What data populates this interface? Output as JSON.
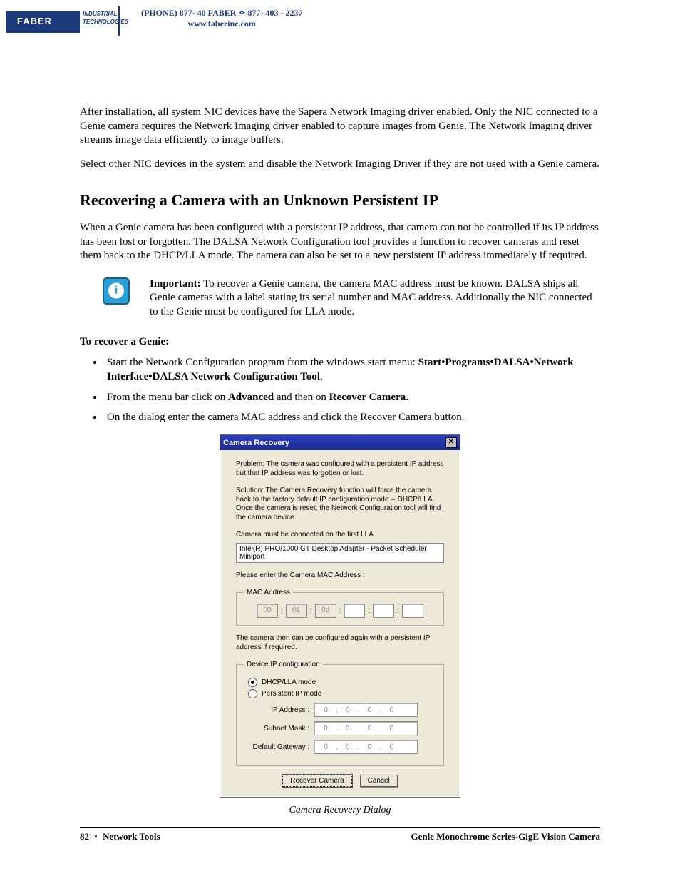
{
  "header": {
    "logo_main": "FABER",
    "logo_sub1": "INDUSTRIAL",
    "logo_sub2": "TECHNOLOGIES",
    "phone_line": "(PHONE) 877- 40 FABER  ✧  877- 403 - 2237",
    "url": "www.faberinc.com"
  },
  "body": {
    "para1": "After installation, all system NIC devices have the Sapera Network Imaging driver enabled. Only the NIC connected to a Genie camera requires the Network Imaging driver enabled to capture images from Genie. The Network Imaging driver streams image data efficiently to image buffers.",
    "para2": "Select other NIC devices in the system and disable the Network Imaging Driver if they are not used with a Genie camera.",
    "h2": "Recovering a Camera with an Unknown Persistent IP",
    "para3": "When a Genie camera has been configured with a persistent IP address, that camera can not be controlled if its IP address has been lost or forgotten. The DALSA Network Configuration tool provides a function to recover cameras and reset them back to the DHCP/LLA mode. The camera can also be set to a new persistent IP address immediately if required.",
    "important_label": "Important:",
    "important_text": " To recover a Genie camera, the camera MAC address must be known. DALSA ships all Genie cameras with a label stating its serial number and MAC address. Additionally the NIC connected to the Genie must be configured for LLA mode.",
    "sub": "To recover a Genie:",
    "li1_a": "Start the Network Configuration program from the windows start menu: ",
    "li1_b": "Start•Programs•DALSA•Network Interface•DALSA Network Configuration Tool",
    "li1_c": ".",
    "li2_a": "From the menu bar click on ",
    "li2_b": "Advanced",
    "li2_c": " and then on ",
    "li2_d": "Recover Camera",
    "li2_e": ".",
    "li3": "On the dialog enter the camera MAC address and click the Recover Camera button."
  },
  "dialog": {
    "title": "Camera Recovery",
    "problem": "Problem: The camera was configured with a persistent IP address but that IP address was forgotten or lost.",
    "solution": "Solution: The Camera Recovery function will force the camera back to the factory default IP configuration mode -- DHCP/LLA. Once the camera is reset, the Network Configuration tool will find the camera device.",
    "lla_note": "Camera must be connected on the first LLA",
    "adapter": "Intel(R) PRO/1000 GT Desktop Adapter - Packet Scheduler Miniport",
    "mac_prompt": "Please enter the Camera MAC Address :",
    "mac_legend": "MAC Address",
    "mac": [
      "00",
      "01",
      "0d",
      "",
      "",
      ""
    ],
    "persist_note": "The camera then can be configured again with a persistent IP address if required.",
    "ip_legend": "Device IP configuration",
    "radio1": "DHCP/LLA mode",
    "radio2": "Persistent IP mode",
    "ip_label": "IP Address :",
    "subnet_label": "Subnet Mask :",
    "gateway_label": "Default Gateway :",
    "octets": [
      "0",
      "0",
      "0",
      "0"
    ],
    "btn_recover": "Recover Camera",
    "btn_cancel": "Cancel",
    "caption": "Camera Recovery Dialog"
  },
  "footer": {
    "page_no": "82",
    "section": "Network Tools",
    "doc_title": "Genie Monochrome Series-GigE Vision Camera"
  }
}
